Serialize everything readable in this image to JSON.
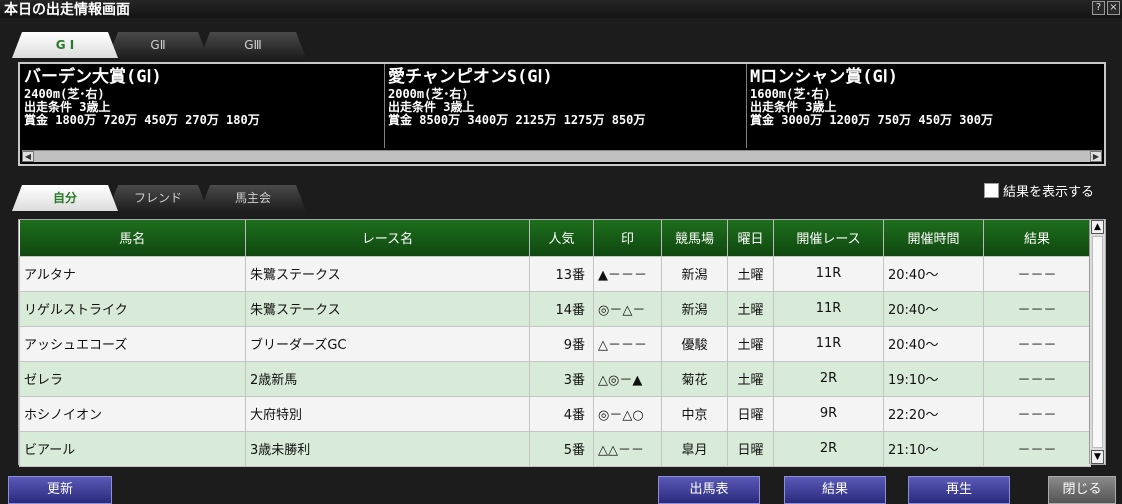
{
  "window": {
    "title": "本日の出走情報画面",
    "help_label": "?",
    "close_label": "×"
  },
  "grade_tabs": [
    {
      "label": "G I",
      "active": true
    },
    {
      "label": "GⅡ",
      "active": false
    },
    {
      "label": "GⅢ",
      "active": false
    }
  ],
  "races": [
    {
      "name": "バーデン大賞(GⅠ)",
      "distance": "2400m(芝･右)",
      "condition": "出走条件 3歳上",
      "prize": "賞金  1800万 720万 450万 270万 180万"
    },
    {
      "name": "愛チャンピオンS(GⅠ)",
      "distance": "2000m(芝･右)",
      "condition": "出走条件 3歳上",
      "prize": "賞金  8500万 3400万 2125万 1275万 850万"
    },
    {
      "name": "Mロンシャン賞(GⅠ)",
      "distance": "1600m(芝･右)",
      "condition": "出走条件 3歳上",
      "prize": "賞金  3000万 1200万 750万 450万 300万"
    }
  ],
  "owner_tabs": [
    {
      "label": "自分",
      "active": true
    },
    {
      "label": "フレンド",
      "active": false
    },
    {
      "label": "馬主会",
      "active": false
    }
  ],
  "show_results": {
    "label": "結果を表示する",
    "checked": false
  },
  "table": {
    "headers": [
      "馬名",
      "レース名",
      "人気",
      "印",
      "競馬場",
      "曜日",
      "開催レース",
      "開催時間",
      "結果"
    ],
    "rows": [
      [
        "アルタナ",
        "朱鷺ステークス",
        "13番",
        "▲－－－",
        "新潟",
        "土曜",
        "11R",
        "20:40～",
        "－－－"
      ],
      [
        "リゲルストライク",
        "朱鷺ステークス",
        "14番",
        "◎－△－",
        "新潟",
        "土曜",
        "11R",
        "20:40～",
        "－－－"
      ],
      [
        "アッシュエコーズ",
        "ブリーダーズGC",
        "9番",
        "△－－－",
        "優駿",
        "土曜",
        "11R",
        "20:40～",
        "－－－"
      ],
      [
        "ゼレラ",
        "2歳新馬",
        "3番",
        "△◎－▲",
        "菊花",
        "土曜",
        "2R",
        "19:10～",
        "－－－"
      ],
      [
        "ホシノイオン",
        "大府特別",
        "4番",
        "◎－△○",
        "中京",
        "日曜",
        "9R",
        "22:20～",
        "－－－"
      ],
      [
        "ビアール",
        "3歳未勝利",
        "5番",
        "△△－－",
        "皐月",
        "日曜",
        "2R",
        "21:10～",
        "－－－"
      ]
    ]
  },
  "buttons": {
    "refresh": "更新",
    "race_card": "出馬表",
    "results": "結果",
    "replay": "再生",
    "close": "閉じる"
  },
  "colors": {
    "header_green": "#1d6e1d",
    "row_green": "#d8ebd8",
    "button_blue": "#3a3a98"
  }
}
